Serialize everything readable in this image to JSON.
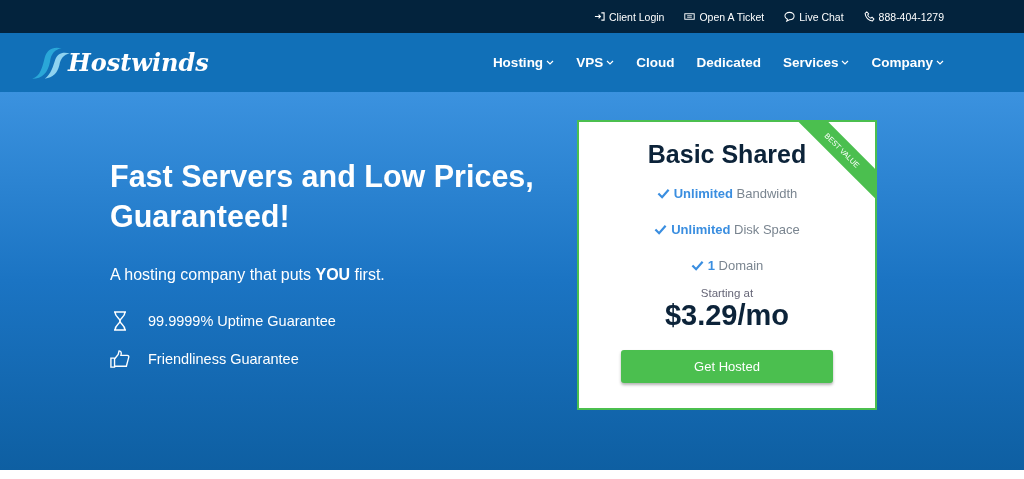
{
  "top_links": [
    {
      "kind": "login",
      "label": "Client Login"
    },
    {
      "kind": "ticket",
      "label": "Open A Ticket"
    },
    {
      "kind": "chat",
      "label": "Live Chat"
    },
    {
      "kind": "phone",
      "label": "888-404-1279"
    }
  ],
  "logo": {
    "text": "Hostwinds"
  },
  "nav": [
    {
      "label": "Hosting",
      "has_menu": true
    },
    {
      "label": "VPS",
      "has_menu": true
    },
    {
      "label": "Cloud",
      "has_menu": false
    },
    {
      "label": "Dedicated",
      "has_menu": false
    },
    {
      "label": "Services",
      "has_menu": true
    },
    {
      "label": "Company",
      "has_menu": true
    }
  ],
  "hero": {
    "title": "Fast Servers and Low Prices, Guaranteed!",
    "subtitle": "A hosting company that puts **YOU** first.",
    "guarantees": [
      {
        "kind": "hourglass",
        "label": "99.9999% Uptime Guarantee"
      },
      {
        "kind": "thumbs-up",
        "label": "Friendliness Guarantee"
      }
    ]
  },
  "plan": {
    "name": "Basic Shared",
    "ribbon": "BEST VALUE",
    "features": [
      "**Unlimited** Bandwidth",
      "**Unlimited** Disk Space",
      "**1** Domain"
    ],
    "price_caption": "Starting at",
    "price": "$3.29/mo",
    "button": "Get Hosted"
  }
}
